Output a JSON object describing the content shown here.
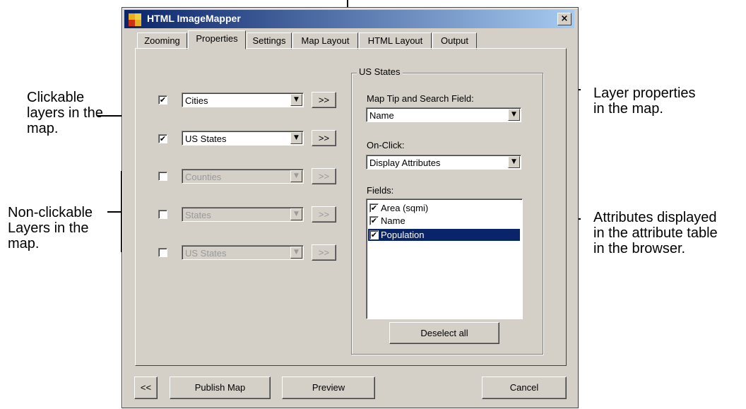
{
  "window": {
    "title": "HTML ImageMapper",
    "close_label": "×"
  },
  "tabs": [
    {
      "label": "Zooming"
    },
    {
      "label": "Properties"
    },
    {
      "label": "Settings"
    },
    {
      "label": "Map Layout"
    },
    {
      "label": "HTML Layout"
    },
    {
      "label": "Output"
    }
  ],
  "layers": [
    {
      "name": "Cities",
      "checked": "✔",
      "more": ">>"
    },
    {
      "name": "US States",
      "checked": "✔",
      "more": ">>"
    },
    {
      "name": "Counties",
      "checked": "",
      "more": ">>"
    },
    {
      "name": "States",
      "checked": "",
      "more": ">>"
    },
    {
      "name": "US States",
      "checked": "",
      "more": ">>"
    }
  ],
  "dropdown_arrow": "▼",
  "props": {
    "group_title": "US States",
    "map_tip_label": "Map Tip and Search Field:",
    "map_tip_value": "Name",
    "onclick_label": "On-Click:",
    "onclick_value": "Display Attributes",
    "fields_label": "Fields:",
    "fields": [
      {
        "name": "Area (sqmi)",
        "check": "✔"
      },
      {
        "name": "Name",
        "check": "✔"
      },
      {
        "name": "Population",
        "check": "✔"
      }
    ],
    "deselect_label": "Deselect all"
  },
  "footer": {
    "back": "<<",
    "publish": "Publish Map",
    "preview": "Preview",
    "cancel": "Cancel"
  },
  "annotations": {
    "clickable": "Clickable\nlayers in the\nmap.",
    "nonclickable": "Non-clickable\nLayers in the\nmap.",
    "layer_props": "Layer properties\nin the map.",
    "attributes": "Attributes displayed\nin the attribute table\nin the browser."
  }
}
